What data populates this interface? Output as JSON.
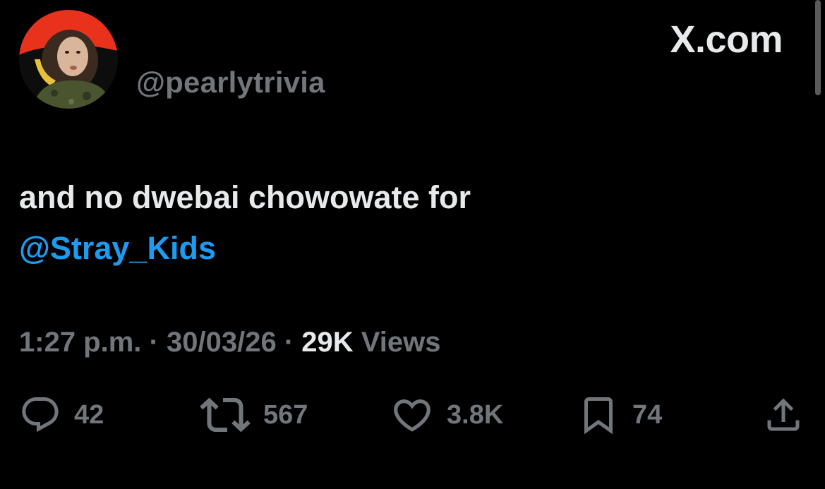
{
  "header": {
    "handle": "@pearlytrivia",
    "brand": "X.com"
  },
  "tweet": {
    "text_line1": "and no dwebai chowowate for",
    "mention": "@Stray_Kids",
    "time": "1:27 p.m.",
    "separator": "·",
    "date": "30/03/26",
    "views_count": "29K",
    "views_label": "Views"
  },
  "actions": {
    "replies": {
      "icon": "reply-icon",
      "count": "42"
    },
    "reposts": {
      "icon": "repost-icon",
      "count": "567"
    },
    "likes": {
      "icon": "heart-icon",
      "count": "3.8K"
    },
    "bookmarks": {
      "icon": "bookmark-icon",
      "count": "74"
    },
    "share": {
      "icon": "share-icon"
    }
  },
  "colors": {
    "background": "#000000",
    "text_primary": "#e7e9ea",
    "text_secondary": "#71767b",
    "link": "#1d9bf0"
  }
}
